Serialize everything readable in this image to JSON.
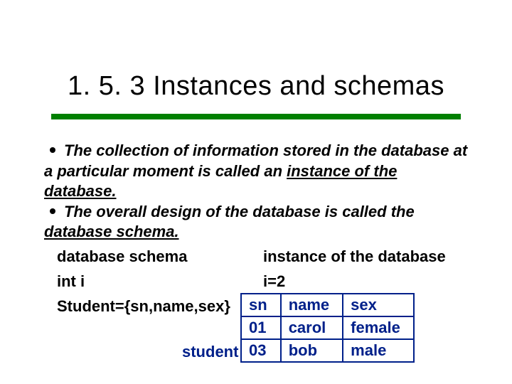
{
  "title": "1. 5. 3   Instances and schemas",
  "bullets": {
    "b1_a": "The collection of information stored in the database at a particular moment is called an ",
    "b1_u": "instance of the database.",
    "b2_a": "The overall design of the database is called the ",
    "b2_u": "database schema."
  },
  "compare": {
    "left1": "database schema",
    "left2": "int  i",
    "right1": "instance of the database",
    "right2": "i=2"
  },
  "schema_line": "Student={sn,name,sex}",
  "student_label": "student",
  "table": {
    "headers": [
      "sn",
      "name",
      "sex"
    ],
    "rows": [
      [
        "01",
        "carol",
        "female"
      ],
      [
        "03",
        "bob",
        "male"
      ]
    ]
  }
}
